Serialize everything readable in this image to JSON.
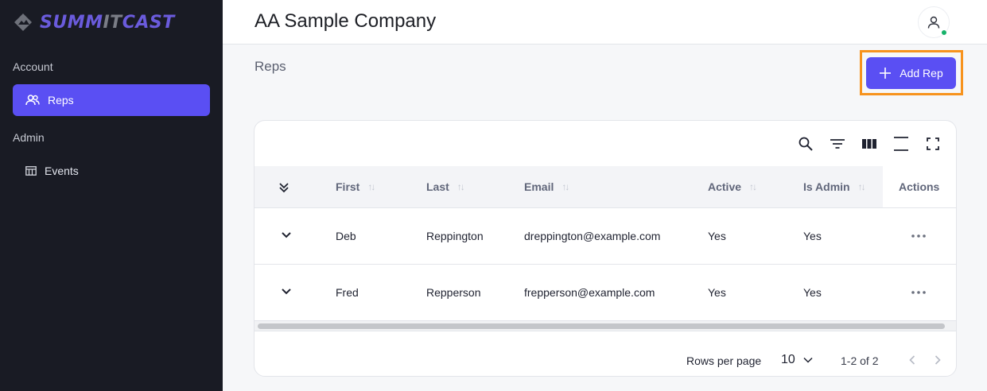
{
  "brand": {
    "part1": "SUMM",
    "part2": "IT",
    "part3": "CAST"
  },
  "sidebar": {
    "sections": [
      {
        "label": "Account",
        "items": [
          {
            "label": "Reps",
            "icon": "users-icon",
            "active": true
          }
        ]
      },
      {
        "label": "Admin",
        "items": [
          {
            "label": "Events",
            "icon": "table-icon",
            "active": false
          }
        ]
      }
    ]
  },
  "header": {
    "title": "AA Sample Company",
    "avatar_icon": "user-icon"
  },
  "main": {
    "section_title": "Reps",
    "add_button_label": "Add Rep"
  },
  "toolbar": {
    "icons": [
      "search-icon",
      "filter-icon",
      "columns-icon",
      "density-icon",
      "fullscreen-icon"
    ]
  },
  "table": {
    "columns": [
      "First",
      "Last",
      "Email",
      "Active",
      "Is Admin"
    ],
    "actions_label": "Actions",
    "rows": [
      {
        "first": "Deb",
        "last": "Reppington",
        "email": "dreppington@example.com",
        "active": "Yes",
        "is_admin": "Yes"
      },
      {
        "first": "Fred",
        "last": "Repperson",
        "email": "frepperson@example.com",
        "active": "Yes",
        "is_admin": "Yes"
      }
    ]
  },
  "pagination": {
    "rows_per_page_label": "Rows per page",
    "rows_per_page": "10",
    "range": "1-2 of 2"
  },
  "colors": {
    "accent": "#5a4ff3",
    "sidebar_bg": "#191b24",
    "highlight": "#f7931e",
    "status_online": "#17b26a"
  }
}
